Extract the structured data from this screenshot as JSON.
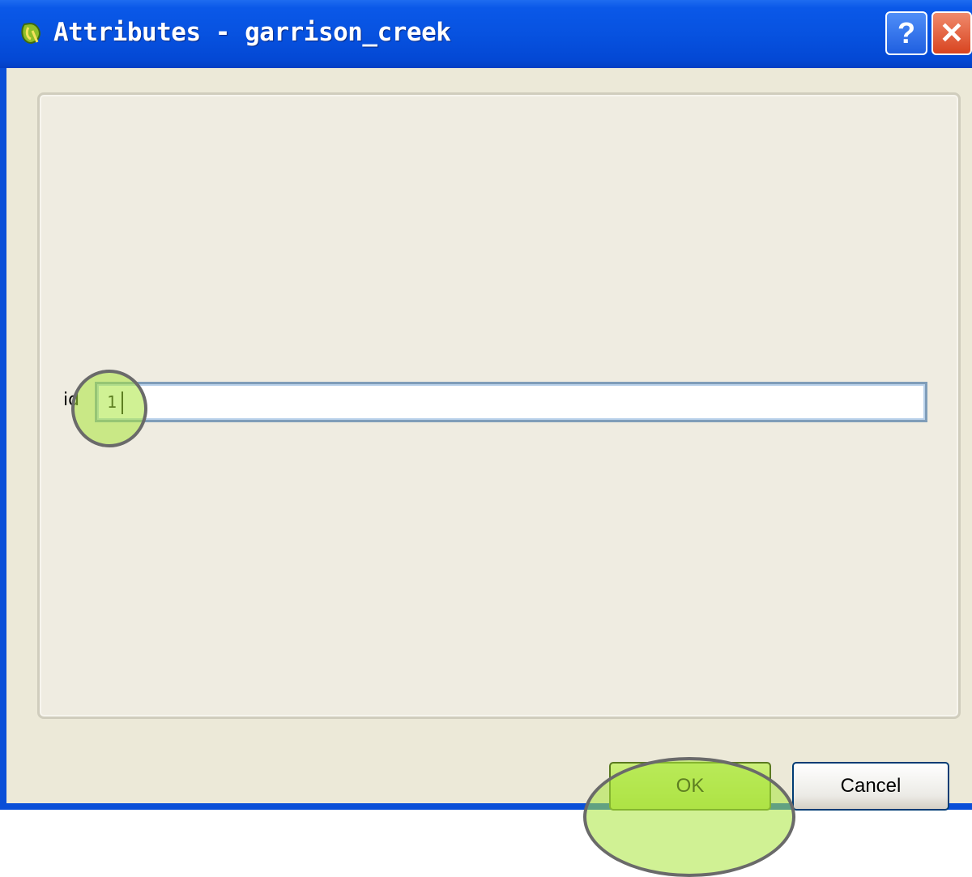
{
  "window": {
    "title": "Attributes - garrison_creek",
    "help_glyph": "?",
    "close_glyph": "✕",
    "icon": "qgis-icon"
  },
  "form": {
    "fields": [
      {
        "label": "id",
        "value": "1"
      }
    ]
  },
  "buttons": {
    "ok_label": "OK",
    "cancel_label": "Cancel"
  },
  "colors": {
    "titlebar": "#0752e0",
    "highlight": "#aae63c",
    "dialog_bg": "#ece9d8"
  }
}
